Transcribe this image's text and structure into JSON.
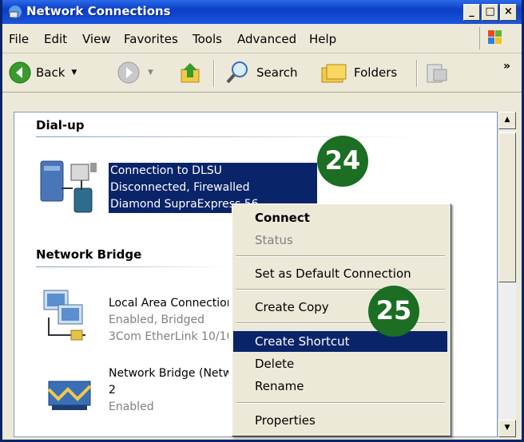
{
  "window": {
    "title": "Network Connections",
    "min": "_",
    "max": "□",
    "close": "×"
  },
  "menu": [
    "File",
    "Edit",
    "View",
    "Favorites",
    "Tools",
    "Advanced",
    "Help"
  ],
  "toolbar": {
    "back": "Back",
    "search": "Search",
    "folders": "Folders",
    "more": "»"
  },
  "groups": {
    "dialup": "Dial-up",
    "bridge": "Network Bridge"
  },
  "items": {
    "dlsu": [
      "Connection to DLSU",
      "Disconnected, Firewalled",
      "Diamond SupraExpress 56"
    ],
    "lan": [
      "Local Area Connection",
      "Enabled, Bridged",
      "3Com EtherLink 10/100"
    ],
    "bridge": [
      "Network Bridge (Network Bridge)",
      "2",
      "Enabled"
    ]
  },
  "context_menu": {
    "connect": "Connect",
    "status": "Status",
    "set_default": "Set as Default Connection",
    "create_copy": "Create Copy",
    "create_shortcut": "Create Shortcut",
    "delete": "Delete",
    "rename": "Rename",
    "properties": "Properties"
  },
  "badges": {
    "step1": "24",
    "step2": "25"
  },
  "colors": {
    "selection": "#0a246a",
    "badge": "#1b6e22",
    "titlebar": "#0a3ec6"
  }
}
